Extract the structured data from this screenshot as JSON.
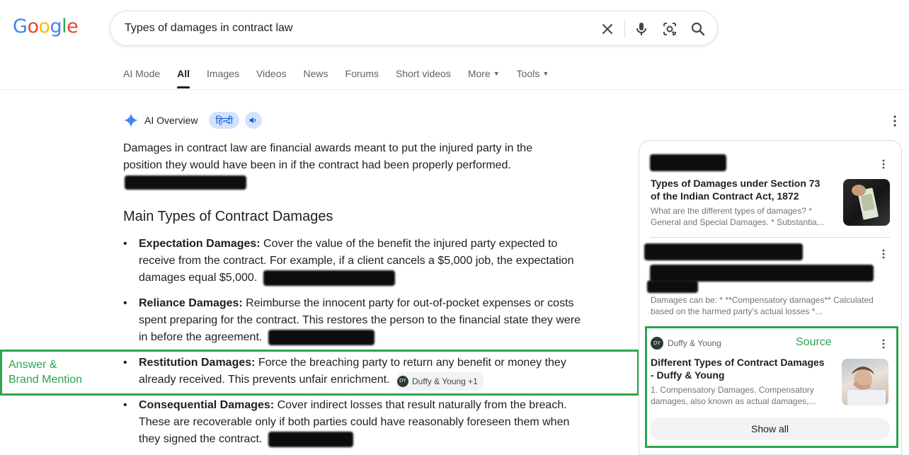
{
  "logo": {
    "text": "Google",
    "letters": [
      "G",
      "o",
      "o",
      "g",
      "l",
      "e"
    ],
    "colors": [
      "#4285F4",
      "#EA4335",
      "#FBBC05",
      "#4285F4",
      "#34A853",
      "#EA4335"
    ]
  },
  "search": {
    "value": "Types of damages in contract law",
    "icons": [
      "close-icon",
      "mic-icon",
      "lens-icon",
      "search-icon"
    ]
  },
  "tabs": [
    {
      "label": "AI Mode"
    },
    {
      "label": "All",
      "active": true
    },
    {
      "label": "Images"
    },
    {
      "label": "Videos"
    },
    {
      "label": "News"
    },
    {
      "label": "Forums"
    },
    {
      "label": "Short videos"
    },
    {
      "label": "More",
      "dropdown": true
    },
    {
      "label": "Tools",
      "dropdown": true
    }
  ],
  "ai_overview": {
    "title": "AI Overview",
    "language_chip": "हिन्दी",
    "intro": "Damages in contract law are financial awards meant to put the injured party in the position they would have been in if the contract had been properly performed.",
    "heading": "Main Types of Contract Damages",
    "items": [
      {
        "term": "Expectation Damages:",
        "text": " Cover the value of the benefit the injured party expected to receive from the contract. For example, if a client cancels a $5,000 job, the expectation damages equal $5,000."
      },
      {
        "term": "Reliance Damages:",
        "text": " Reimburse the innocent party for out-of-pocket expenses or costs spent preparing for the contract. This restores the person to the financial state they were in before the agreement."
      },
      {
        "term": "Restitution Damages:",
        "text": " Force the breaching party to return any benefit or money they already received. This prevents unfair enrichment.",
        "citation": "Duffy & Young +1"
      },
      {
        "term": "Consequential Damages:",
        "text": " Cover indirect losses that result naturally from the breach. These are recoverable only if both parties could have reasonably foreseen them when they signed the contract."
      }
    ]
  },
  "annotations": {
    "answer_label": "Answer &\nBrand Mention",
    "source_label": "Source",
    "color": "#2ea44f"
  },
  "sources": {
    "cards": [
      {
        "title": "Types of Damages under Section 73 of the Indian Contract Act, 1872",
        "snippet": "What are the different types of damages? * General and Special Damages. * Substantia..."
      },
      {
        "snippet": "Damages can be: * **Compensatory damages** Calculated based on the harmed party's actual losses *..."
      },
      {
        "site": "Duffy & Young",
        "title": "Different Types of Contract Damages - Duffy & Young",
        "snippet": "1. Compensatory Damages. Compensatory damages, also known as actual damages,..."
      }
    ],
    "show_all": "Show all"
  }
}
